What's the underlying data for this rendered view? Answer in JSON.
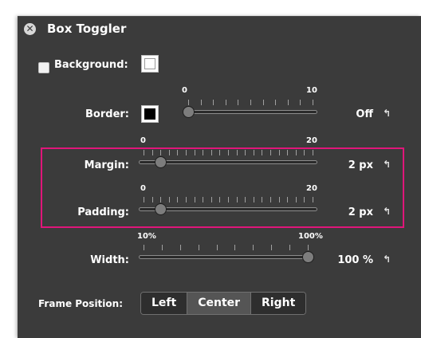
{
  "panel": {
    "title": "Box Toggler",
    "close_icon": "close-icon"
  },
  "background": {
    "label": "Background:",
    "checked": false,
    "swatch_color": "#ffffff"
  },
  "border": {
    "label": "Border:",
    "swatch_color": "#000000",
    "min_label": "0",
    "max_label": "10",
    "value_fraction": 0.0,
    "value_text": "Off",
    "tick_count": 11
  },
  "margin": {
    "label": "Margin:",
    "min_label": "0",
    "max_label": "20",
    "value_fraction": 0.1,
    "value_text": "2 px",
    "tick_count": 21
  },
  "padding": {
    "label": "Padding:",
    "min_label": "0",
    "max_label": "20",
    "value_fraction": 0.1,
    "value_text": "2 px",
    "tick_count": 21
  },
  "width": {
    "label": "Width:",
    "min_label": "10%",
    "max_label": "100%",
    "value_fraction": 1.0,
    "value_text": "100 %",
    "tick_count": 10
  },
  "frame_position": {
    "label": "Frame Position:",
    "options": [
      "Left",
      "Center",
      "Right"
    ],
    "selected": "Center"
  },
  "reset_icon": "undo-arrow-icon",
  "colors": {
    "panel_bg": "#3b3b3b",
    "highlight": "#e0167a"
  }
}
